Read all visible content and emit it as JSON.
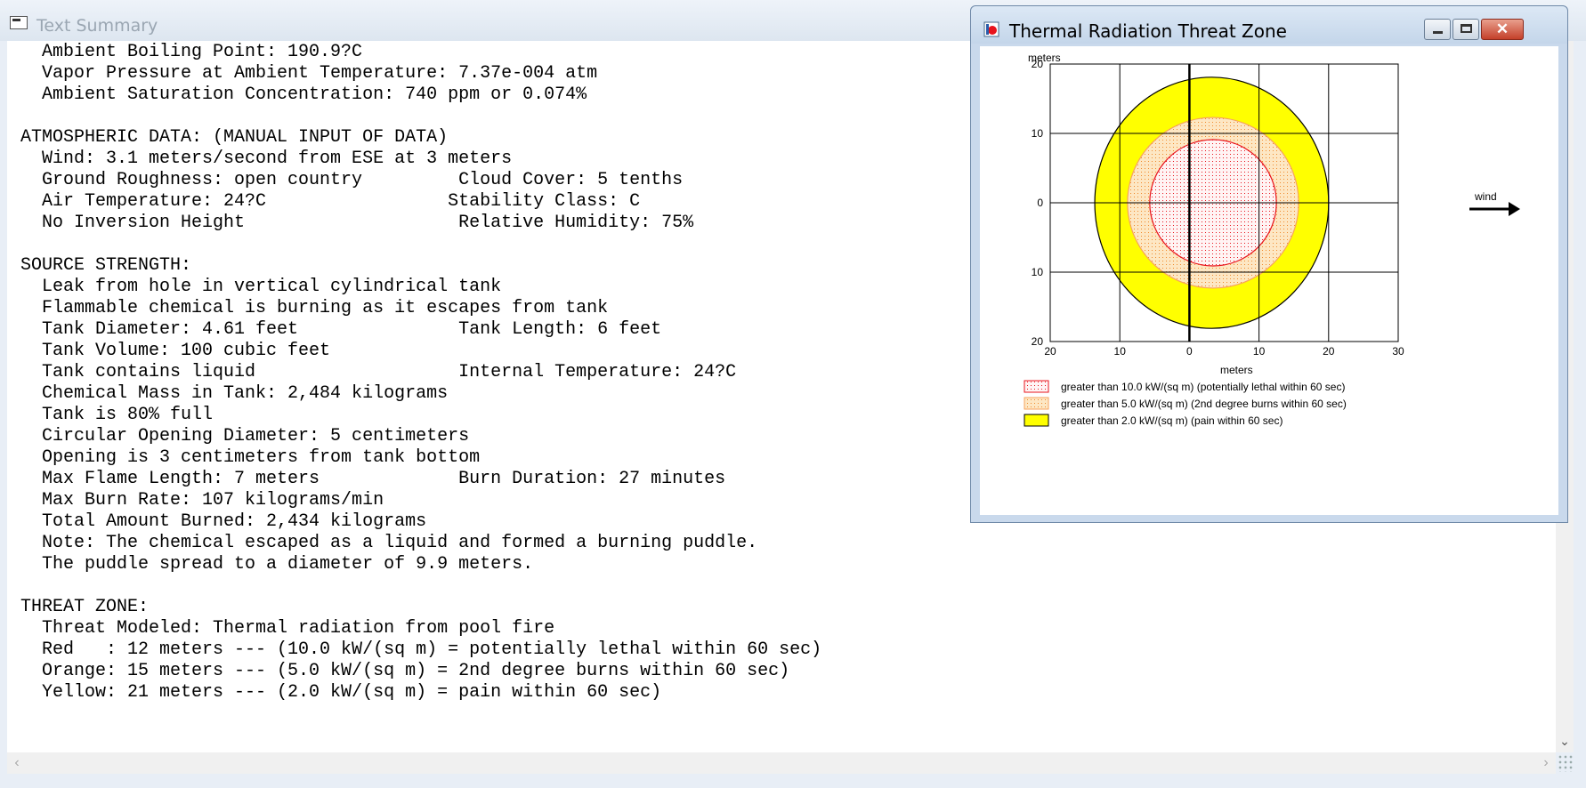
{
  "main_window": {
    "title": "Text Summary",
    "lines": [
      "  Ambient Boiling Point: 190.9?C",
      "  Vapor Pressure at Ambient Temperature: 7.37e-004 atm",
      "  Ambient Saturation Concentration: 740 ppm or 0.074%",
      "",
      "ATMOSPHERIC DATA: (MANUAL INPUT OF DATA)",
      "  Wind: 3.1 meters/second from ESE at 3 meters",
      "  Ground Roughness: open country         Cloud Cover: 5 tenths",
      "  Air Temperature: 24?C                 Stability Class: C",
      "  No Inversion Height                    Relative Humidity: 75%",
      "",
      "SOURCE STRENGTH:",
      "  Leak from hole in vertical cylindrical tank",
      "  Flammable chemical is burning as it escapes from tank",
      "  Tank Diameter: 4.61 feet               Tank Length: 6 feet",
      "  Tank Volume: 100 cubic feet",
      "  Tank contains liquid                   Internal Temperature: 24?C",
      "  Chemical Mass in Tank: 2,484 kilograms",
      "  Tank is 80% full",
      "  Circular Opening Diameter: 5 centimeters",
      "  Opening is 3 centimeters from tank bottom",
      "  Max Flame Length: 7 meters             Burn Duration: 27 minutes",
      "  Max Burn Rate: 107 kilograms/min",
      "  Total Amount Burned: 2,434 kilograms",
      "  Note: The chemical escaped as a liquid and formed a burning puddle.",
      "  The puddle spread to a diameter of 9.9 meters.",
      "",
      "THREAT ZONE:",
      "  Threat Modeled: Thermal radiation from pool fire",
      "  Red   : 12 meters --- (10.0 kW/(sq m) = potentially lethal within 60 sec)",
      "  Orange: 15 meters --- (5.0 kW/(sq m) = 2nd degree burns within 60 sec)",
      "  Yellow: 21 meters --- (2.0 kW/(sq m) = pain within 60 sec)"
    ]
  },
  "threat_window": {
    "title": "Thermal Radiation Threat Zone",
    "close_symbol": "✕",
    "wind_label": "wind",
    "plot": {
      "y_unit_label": "meters",
      "x_unit_label": "meters",
      "x_ticks": [
        "20",
        "10",
        "0",
        "10",
        "20",
        "30"
      ],
      "x_tick_values": [
        -20,
        -10,
        0,
        10,
        20,
        30
      ],
      "y_ticks": [
        "20",
        "10",
        "0",
        "10",
        "20"
      ],
      "y_tick_values": [
        20,
        10,
        0,
        -10,
        -20
      ],
      "xlim": [
        -20,
        30
      ],
      "ylim": [
        -20,
        20
      ],
      "zones": [
        {
          "name": "yellow",
          "fill": "#ffff00",
          "stroke": "#000000",
          "cx": 3.2,
          "cy": 0,
          "rx": 16.8,
          "ry": 18.1,
          "pattern": "solid"
        },
        {
          "name": "orange",
          "fill": "#fde0b0",
          "stroke": "#f7a35c",
          "cx": 3.4,
          "cy": 0,
          "rx": 12.3,
          "ry": 12.3,
          "pattern": "dots-orange"
        },
        {
          "name": "red",
          "fill": "#fbe4e4",
          "stroke": "#e8141c",
          "cx": 3.4,
          "cy": 0,
          "rx": 9.1,
          "ry": 9.1,
          "pattern": "dots-red"
        }
      ]
    },
    "legend": [
      {
        "label": "greater than 10.0 kW/(sq m) (potentially lethal within 60 sec)",
        "swatch": "dots-red",
        "border": "#e8141c"
      },
      {
        "label": "greater than 5.0 kW/(sq m) (2nd degree burns within 60 sec)",
        "swatch": "dots-orange",
        "border": "#f7a35c"
      },
      {
        "label": "greater than 2.0 kW/(sq m) (pain within 60 sec)",
        "swatch": "solid-yellow",
        "border": "#000000"
      }
    ]
  }
}
